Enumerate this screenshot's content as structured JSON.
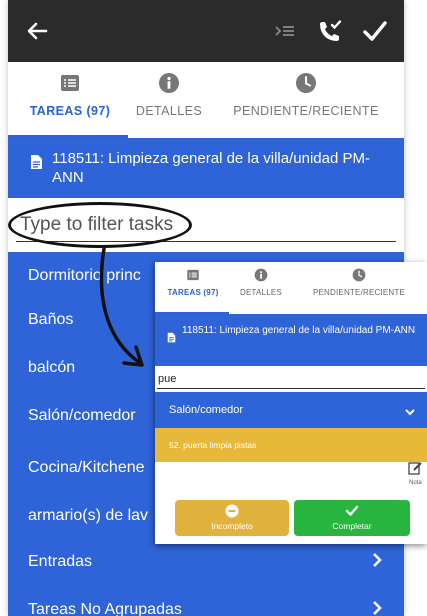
{
  "colors": {
    "accent": "#2f63d8",
    "topbar": "#2b2b2b",
    "task_highlight": "#e8b83a",
    "incomplete": "#e1b23c",
    "complete": "#27b43f"
  },
  "topbar": {
    "icons": [
      "back-arrow-icon",
      "indent-list-icon",
      "phone-check-icon",
      "checkmark-icon"
    ]
  },
  "tabs": [
    {
      "label": "TAREAS (97)",
      "icon": "list-icon",
      "active": true
    },
    {
      "label": "DETALLES",
      "icon": "info-icon",
      "active": false
    },
    {
      "label": "PENDIENTE/RECIENTE",
      "icon": "clock-icon",
      "active": false
    }
  ],
  "task": {
    "title": "118511: Limpieza general de la villa/unidad PM-ANN",
    "icon": "document-icon"
  },
  "filter": {
    "placeholder": "Type to filter tasks"
  },
  "list": {
    "items": [
      "Dormitorio princ",
      "Baños",
      "balcón",
      "Salón/comedor",
      "Cocina/Kitchene",
      "armario(s) de lav",
      "Entradas",
      "Tareas No Agrupadas"
    ]
  },
  "inset": {
    "tabs": [
      {
        "label": "TAREAS (97)",
        "icon": "list-icon",
        "active": true
      },
      {
        "label": "DETALLES",
        "icon": "info-icon",
        "active": false
      },
      {
        "label": "PENDIENTE/RECIENTE",
        "icon": "clock-icon",
        "active": false
      }
    ],
    "task_title": "118511: Limpieza general de la villa/unidad PM-ANN",
    "filter_value": "pue",
    "group_label": "Salón/comedor",
    "task_item": "52. puerta limpia pistas",
    "note_label": "Nota",
    "incomplete_label": "Incompleto",
    "complete_label": "Completar"
  }
}
